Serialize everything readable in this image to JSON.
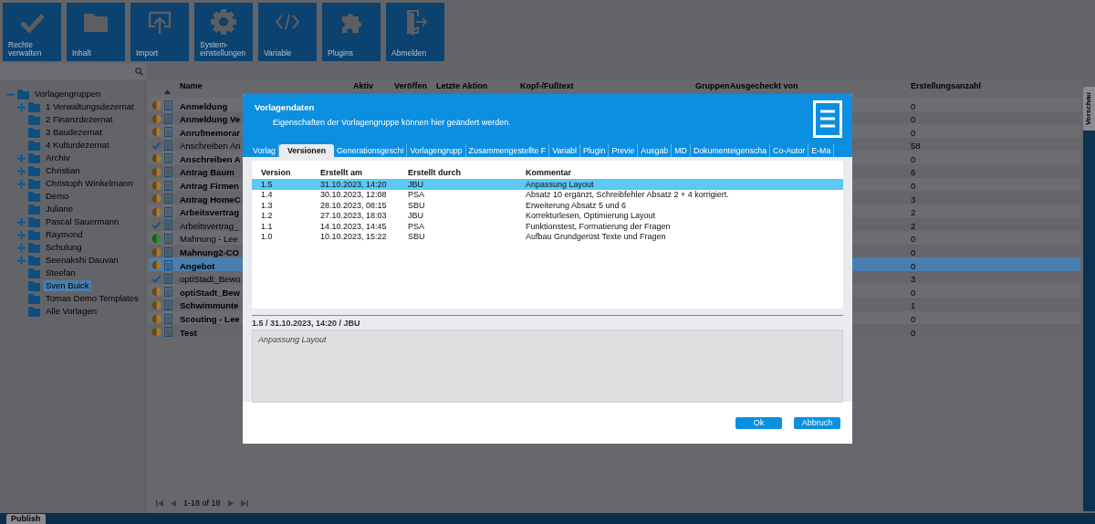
{
  "toolbar": [
    {
      "label": "Rechte verwalten"
    },
    {
      "label": "Inhalt"
    },
    {
      "label": "Import"
    },
    {
      "label": "System-einstellungen"
    },
    {
      "label": "Variable"
    },
    {
      "label": "Plugins"
    },
    {
      "label": "Abmelden"
    }
  ],
  "tree": {
    "items": [
      {
        "label": "Vorlagengruppen",
        "expanded": true,
        "selected": false,
        "children": [
          {
            "label": "1 Verwaltungsdezernat",
            "expanded": false,
            "selected": false
          },
          {
            "label": "2 Finanzdezernat",
            "selected": false
          },
          {
            "label": "3 Baudezernat",
            "selected": false
          },
          {
            "label": "4 Kulturdezernat",
            "selected": false
          },
          {
            "label": "Archiv",
            "expanded": false,
            "selected": false
          },
          {
            "label": "Christian",
            "expanded": false,
            "selected": false
          },
          {
            "label": "Christoph Winkelmann",
            "expanded": false,
            "selected": false
          },
          {
            "label": "Demo",
            "selected": false
          },
          {
            "label": "Juliane",
            "selected": false
          },
          {
            "label": "Pascal Sauermann",
            "expanded": false,
            "selected": false
          },
          {
            "label": "Raymond",
            "expanded": false,
            "selected": false
          },
          {
            "label": "Schulung",
            "expanded": false,
            "selected": false
          },
          {
            "label": "Seenakshi Dauvan",
            "expanded": false,
            "selected": false
          },
          {
            "label": "Steefan",
            "selected": false
          },
          {
            "label": "Sven Buick",
            "selected": true
          },
          {
            "label": "Tomas Demo Templates",
            "selected": false
          },
          {
            "label": "Alle Vorlagen",
            "selected": false
          }
        ]
      }
    ]
  },
  "table": {
    "columns": [
      "Name",
      "Aktiv",
      "Veröffen",
      "Letzte Aktion",
      "Kopf-/Fußtext",
      "Gruppen",
      "Ausgecheckt von",
      "Erstellungsanzahl"
    ],
    "rows": [
      {
        "kind": "draft",
        "name": "Anmeldung",
        "bold": true,
        "count": "0",
        "selected": false
      },
      {
        "kind": "draft",
        "name": "Anmeldung Ve",
        "bold": true,
        "count": "0",
        "selected": false
      },
      {
        "kind": "draft",
        "name": "Anrufmemorar",
        "bold": true,
        "count": "0",
        "selected": false
      },
      {
        "kind": "released",
        "name": "Anschreiben An",
        "bold": false,
        "count": "58",
        "selected": false
      },
      {
        "kind": "draft",
        "name": "Anschreiben A",
        "bold": true,
        "count": "0",
        "selected": false
      },
      {
        "kind": "draft",
        "name": "Antrag Baum",
        "bold": true,
        "count": "6",
        "selected": false
      },
      {
        "kind": "draft",
        "name": "Antrag Firmen",
        "bold": true,
        "count": "0",
        "selected": false
      },
      {
        "kind": "draft",
        "name": "Antrag HomeC",
        "bold": true,
        "count": "3",
        "selected": false
      },
      {
        "kind": "draft",
        "name": "Arbeitsvertrag",
        "bold": true,
        "count": "2",
        "selected": false
      },
      {
        "kind": "released",
        "name": "Arbeitsvertrag_",
        "bold": false,
        "count": "2",
        "selected": false
      },
      {
        "kind": "active",
        "name": "Mahnung - Lee",
        "bold": false,
        "count": "0",
        "selected": false
      },
      {
        "kind": "draft",
        "name": "Mahnung2-CO",
        "bold": true,
        "count": "0",
        "selected": false
      },
      {
        "kind": "draft",
        "name": "Angebot",
        "bold": true,
        "count": "0",
        "selected": true
      },
      {
        "kind": "released",
        "name": "optiStadt_Bewo",
        "bold": false,
        "count": "3",
        "selected": false
      },
      {
        "kind": "draft",
        "name": "optiStadt_Bew",
        "bold": true,
        "count": "0",
        "selected": false
      },
      {
        "kind": "draft",
        "name": "Schwimmunte",
        "bold": true,
        "count": "1",
        "selected": false
      },
      {
        "kind": "draft",
        "name": "Scouting - Lee",
        "bold": true,
        "count": "0",
        "selected": false
      },
      {
        "kind": "draft",
        "name": "Test",
        "bold": true,
        "count": "0",
        "selected": false
      }
    ]
  },
  "pager": {
    "text": "1-18 of 18"
  },
  "side_tab": {
    "label": "Vorschau"
  },
  "bottom_bar": {
    "tabs": [
      {
        "label": "Publish",
        "selected": true
      }
    ]
  },
  "dialog": {
    "title": "Vorlagendaten",
    "subtitle": "Eigenschaften der Vorlagengruppe können hier geändert werden.",
    "tabs": [
      {
        "label": "Vorlag",
        "selected": false
      },
      {
        "label": "Versionen",
        "selected": true
      },
      {
        "label": "Generationsgeschi",
        "selected": false
      },
      {
        "label": "Vorlagengrupp",
        "selected": false
      },
      {
        "label": "Zusammengestellte F",
        "selected": false
      },
      {
        "label": "Variabl",
        "selected": false
      },
      {
        "label": "Plugin",
        "selected": false
      },
      {
        "label": "Previe",
        "selected": false
      },
      {
        "label": "Ausgab",
        "selected": false
      },
      {
        "label": "MD",
        "selected": false
      },
      {
        "label": "Dokumenteigenscha",
        "selected": false
      },
      {
        "label": "Co-Autor",
        "selected": false
      },
      {
        "label": "E-Ma",
        "selected": false
      }
    ],
    "versions": {
      "columns": [
        "Version",
        "Erstellt am",
        "Erstellt durch",
        "Kommentar"
      ],
      "rows": [
        {
          "cells": [
            "1.5",
            "31.10.2023, 14:20",
            "JBU",
            "Anpassung Layout"
          ],
          "selected": true
        },
        {
          "cells": [
            "1.4",
            "30.10.2023, 12:08",
            "PSA",
            "Absatz 10 ergänzt, Schreibfehler Absatz 2 + 4 korrigiert."
          ],
          "selected": false
        },
        {
          "cells": [
            "1.3",
            "28.10.2023, 08:15",
            "SBU",
            "Erweiterung Absatz 5 und 6"
          ],
          "selected": false
        },
        {
          "cells": [
            "1.2",
            "27.10.2023, 18:03",
            "JBU",
            "Korrekturlesen, Optimierung Layout"
          ],
          "selected": false
        },
        {
          "cells": [
            "1.1",
            "14.10.2023, 14:45",
            "PSA",
            "Funktionstest, Formatierung der Fragen"
          ],
          "selected": false
        },
        {
          "cells": [
            "1.0",
            "10.10.2023, 15:22",
            "SBU",
            "Aufbau Grundgerüst Texte und Fragen"
          ],
          "selected": false
        }
      ]
    },
    "detail_label": "1.5 / 31.10.2023, 14:20 / JBU",
    "comment": "Anpassung Layout",
    "buttons": [
      "Ok",
      "Abbruch"
    ]
  }
}
